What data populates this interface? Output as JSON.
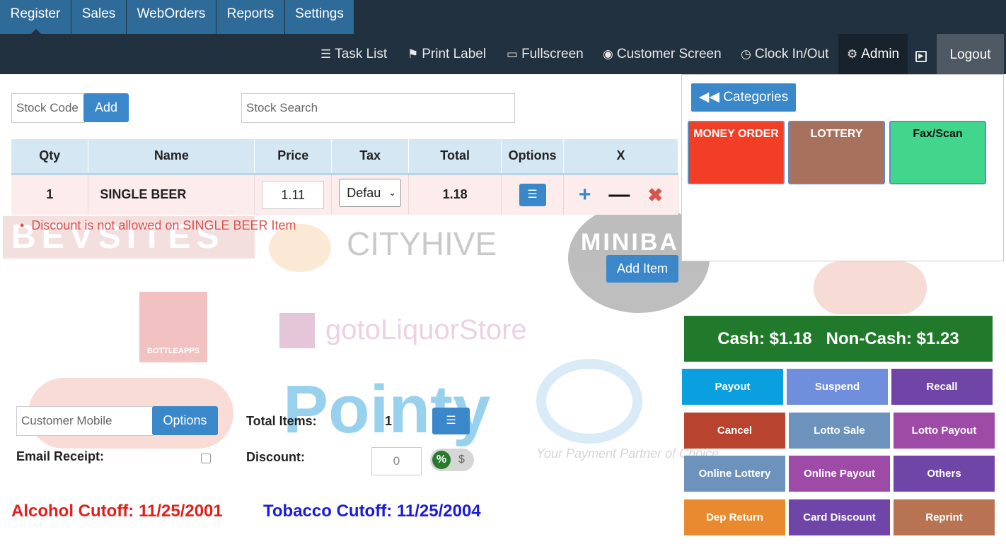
{
  "nav": {
    "tabs": [
      "Register",
      "Sales",
      "WebOrders",
      "Reports",
      "Settings"
    ]
  },
  "toolbar": {
    "task_list": "Task List",
    "print_label": "Print Label",
    "fullscreen": "Fullscreen",
    "customer_screen": "Customer Screen",
    "clock": "Clock In/Out",
    "admin": "Admin",
    "logout": "Logout"
  },
  "entry": {
    "stock_code_placeholder": "Stock Code",
    "add_label": "Add",
    "stock_search_placeholder": "Stock Search"
  },
  "cart": {
    "headers": [
      "Qty",
      "Name",
      "Price",
      "Tax",
      "Total",
      "Options",
      "X"
    ],
    "rows": [
      {
        "qty": "1",
        "name": "SINGLE BEER",
        "price": "1.11",
        "tax": "Defau",
        "total": "1.18"
      }
    ],
    "error": "Discount is not allowed on SINGLE BEER Item",
    "add_item": "Add Item"
  },
  "categories": {
    "back_label": "Categories",
    "tiles": [
      {
        "label": "MONEY ORDER",
        "color": "#f33e26",
        "text_color": "#ffffff"
      },
      {
        "label": "LOTTERY",
        "color": "#a8715d",
        "text_color": "#ffffff"
      },
      {
        "label": "Fax/Scan",
        "color": "#42d68d",
        "text_color": "#111111"
      }
    ]
  },
  "totals": {
    "cash": "Cash: $1.18",
    "noncash": "Non-Cash: $1.23"
  },
  "actions": [
    {
      "label": "Payout",
      "color": "#0aa0e0"
    },
    {
      "label": "Suspend",
      "color": "#6f8fdd"
    },
    {
      "label": "Recall",
      "color": "#6f45a8"
    },
    {
      "label": "Cancel",
      "color": "#b8432f"
    },
    {
      "label": "Lotto Sale",
      "color": "#6d93bd"
    },
    {
      "label": "Lotto Payout",
      "color": "#9e4ba8"
    },
    {
      "label": "Online Lottery",
      "color": "#6d93bd"
    },
    {
      "label": "Online Payout",
      "color": "#9e4ba8"
    },
    {
      "label": "Others",
      "color": "#6f45a8"
    },
    {
      "label": "Dep Return",
      "color": "#e98a2e"
    },
    {
      "label": "Card Discount",
      "color": "#6f45a8"
    },
    {
      "label": "Reprint",
      "color": "#b87452"
    }
  ],
  "customer": {
    "mobile_placeholder": "Customer Mobile",
    "options_label": "Options",
    "email_receipt": "Email Receipt:",
    "total_items_label": "Total Items:",
    "total_items_value": "1",
    "discount_label": "Discount:",
    "discount_value": "0",
    "pct_symbol": "%",
    "dollar_symbol": "$"
  },
  "cutoffs": {
    "alcohol": "Alcohol Cutoff: 11/25/2001",
    "tobacco": "Tobacco Cutoff: 11/25/2004"
  },
  "watermarks": [
    "BEVSITES",
    "CITYHIVE",
    "MINIBA",
    "BOTTLEAPPS",
    "gotoLiquorStore",
    "Pointy",
    "Your Payment Partner of Choice"
  ]
}
